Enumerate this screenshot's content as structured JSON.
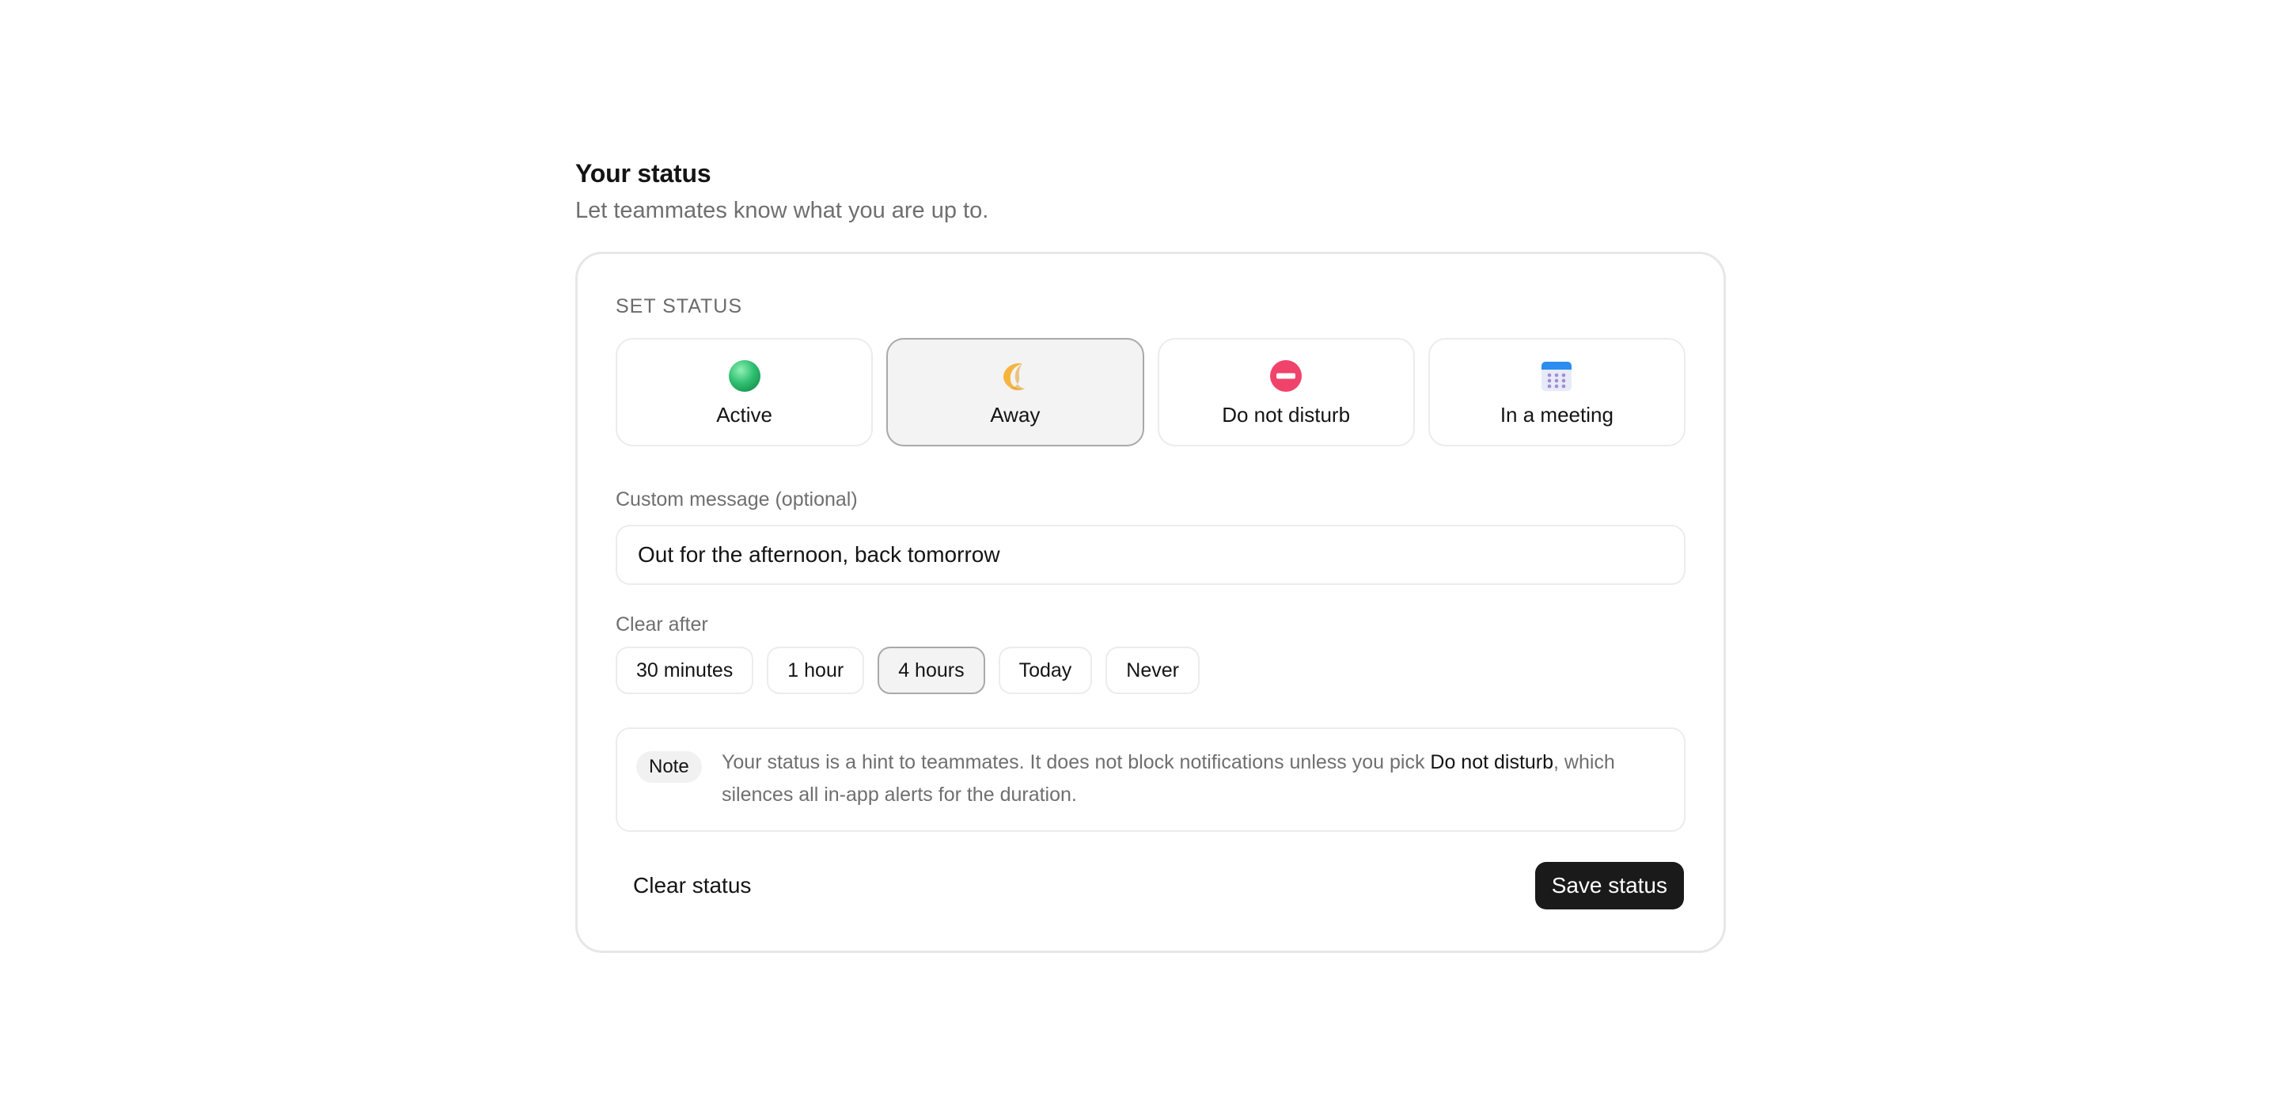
{
  "header": {
    "title": "Your status",
    "subtitle": "Let teammates know what you are up to."
  },
  "set_status": {
    "label": "SET STATUS",
    "options": [
      {
        "label": "Active",
        "icon": "green-dot-icon",
        "selected": false
      },
      {
        "label": "Away",
        "icon": "crescent-moon-icon",
        "selected": true
      },
      {
        "label": "Do not disturb",
        "icon": "no-entry-icon",
        "selected": false
      },
      {
        "label": "In a meeting",
        "icon": "calendar-icon",
        "selected": false
      }
    ]
  },
  "custom_message": {
    "label": "Custom message (optional)",
    "value": "Out for the afternoon, back tomorrow"
  },
  "clear_after": {
    "label": "Clear after",
    "options": [
      "30 minutes",
      "1 hour",
      "4 hours",
      "Today",
      "Never"
    ],
    "selected": "4 hours"
  },
  "note": {
    "badge": "Note",
    "text_before": "Your status is a hint to teammates. It does not block notifications unless you pick ",
    "text_emphasis": "Do not disturb",
    "text_after": ", which silences all in-app alerts for the duration."
  },
  "actions": {
    "clear_label": "Clear status",
    "save_label": "Save status"
  },
  "colors": {
    "primary_button": "#1a1a1a",
    "selected_bg": "#f3f3f3",
    "active_green": "#2fbf71",
    "dnd_red": "#f0436b",
    "calendar_blue": "#2d8cf0"
  }
}
